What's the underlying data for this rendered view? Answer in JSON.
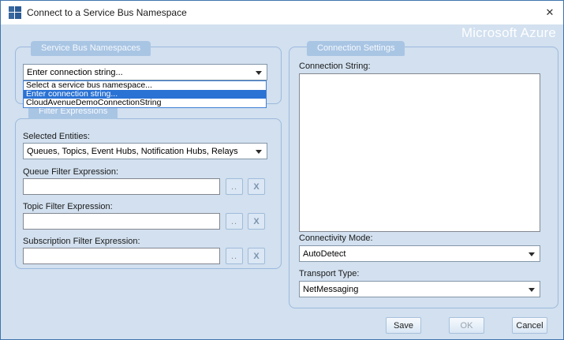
{
  "window": {
    "title": "Connect to a Service Bus Namespace",
    "close_label": "✕",
    "brand": "Microsoft Azure"
  },
  "namespaces_group": {
    "title": "Service Bus Namespaces",
    "combo_value": "Enter connection string...",
    "dropdown": {
      "items": [
        "Select a service bus namespace...",
        "Enter connection string...",
        "CloudAvenueDemoConnectionString"
      ],
      "highlighted_index": 1
    }
  },
  "filters_group": {
    "title": "Filter Expressions",
    "selected_entities_label": "Selected Entities:",
    "selected_entities_value": "Queues, Topics, Event Hubs, Notification Hubs, Relays",
    "fields": [
      {
        "label": "Queue Filter Expression:",
        "value": "",
        "browse_label": "..",
        "clear_label": "X"
      },
      {
        "label": "Topic Filter Expression:",
        "value": "",
        "browse_label": "..",
        "clear_label": "X"
      },
      {
        "label": "Subscription Filter Expression:",
        "value": "",
        "browse_label": "..",
        "clear_label": "X"
      }
    ]
  },
  "connection_group": {
    "title": "Connection Settings",
    "connection_string_label": "Connection String:",
    "connection_string_value": "",
    "connectivity_mode_label": "Connectivity Mode:",
    "connectivity_mode_value": "AutoDetect",
    "transport_type_label": "Transport Type:",
    "transport_type_value": "NetMessaging"
  },
  "footer": {
    "save_label": "Save",
    "ok_label": "OK",
    "ok_enabled": false,
    "cancel_label": "Cancel"
  },
  "colors": {
    "window_border": "#3f74ae",
    "content_bg": "#d2e0ef",
    "titlebar_bg": "#ffffff",
    "group_tab_bg": "#a9c5e4",
    "group_border": "#9cb9dd",
    "dropdown_highlight": "#2a72d4",
    "dropdown_border": "#3e7fd6"
  }
}
